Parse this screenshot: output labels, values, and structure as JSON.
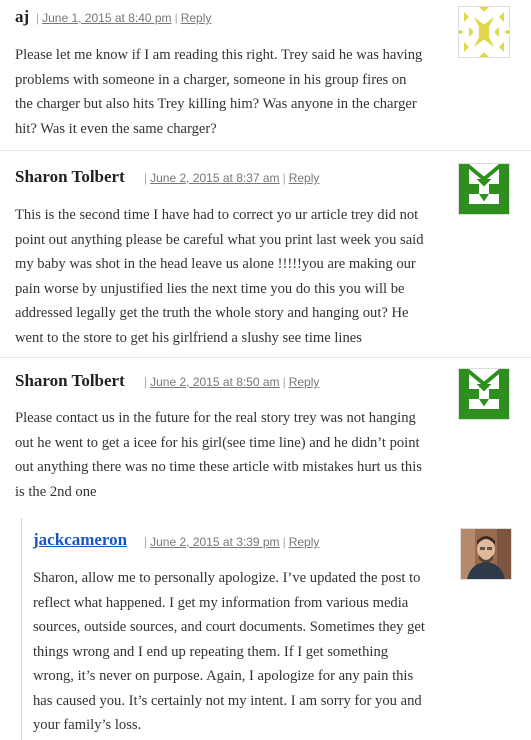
{
  "comments": [
    {
      "author": "aj",
      "date": "June 1, 2015 at 8:40 pm",
      "reply": "Reply",
      "lines": [
        "Please let me know if I am reading this right. Trey said he was having",
        "problems with someone in a charger, someone in his group fires on",
        "the charger but also hits Trey killing him? Was anyone in the charger",
        "hit? Was it even the same charger?"
      ]
    },
    {
      "author": "Sharon Tolbert",
      "date": "June 2, 2015 at 8:37 am",
      "reply": "Reply",
      "lines": [
        "This is the second time I have had to correct yo ur article trey did not",
        "point out anything please be careful what you print last week you said",
        "my baby was shot in the head leave us alone !!!!!you are making our",
        "pain worse by unjustified lies the next time you do this you will be",
        "addressed legally get the truth the whole story and hanging out? He",
        "went to the store to get his girlfriend a slushy see time lines"
      ]
    },
    {
      "author": "Sharon Tolbert",
      "date": "June 2, 2015 at 8:50 am",
      "reply": "Reply",
      "lines": [
        "Please contact us in the future for the real story trey was not hanging",
        "out he went to get a icee for his girl(see time line) and he didn’t point",
        "out anything there was no time these article witb mistakes hurt us this",
        "is the 2nd one"
      ]
    },
    {
      "author": "jackcameron",
      "date": "June 2, 2015 at 3:39 pm",
      "reply": "Reply",
      "lines": [
        "Sharon, allow me to personally apologize. I’ve updated the post to",
        "reflect what happened. I get my information from various media",
        "sources, outside sources, and court documents. Sometimes they get",
        "things wrong and I end up repeating them. If I get something",
        "wrong, it’s never on purpose. Again, I apologize for any pain this",
        "has caused you. It’s certainly not my intent. I am sorry for you and",
        "your family’s loss."
      ]
    }
  ],
  "separator": "|",
  "colors": {
    "identicon_yellow": "#e0d84a",
    "identicon_green": "#2e8f1f",
    "author_link": "#1b57c2"
  },
  "avatars": [
    "yellow-identicon",
    "green-identicon",
    "green-identicon",
    "photo-avatar"
  ]
}
